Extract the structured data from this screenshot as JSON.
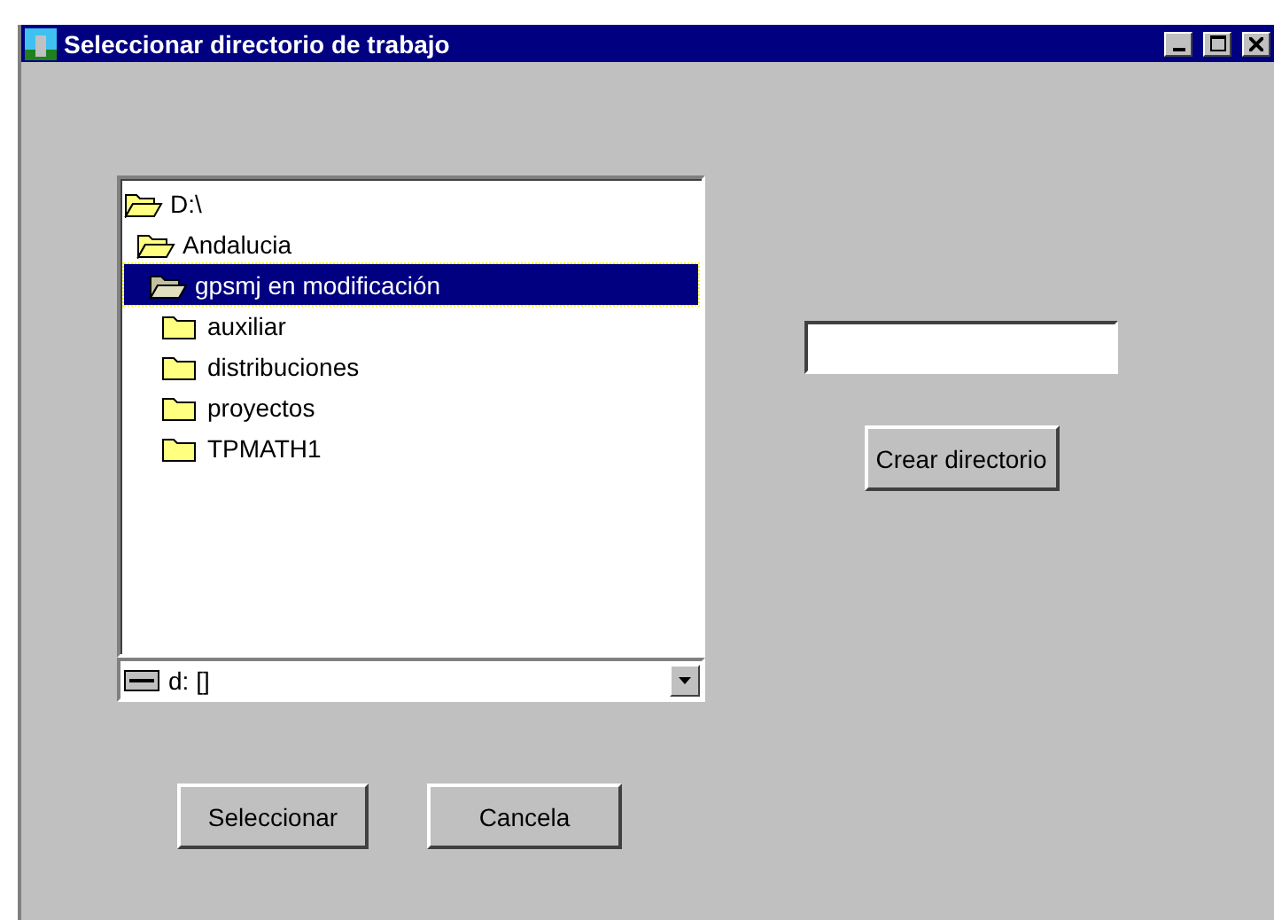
{
  "window": {
    "title": "Seleccionar directorio de trabajo"
  },
  "tree": [
    {
      "label": "D:\\",
      "expanded": true,
      "selected": false,
      "children": [
        {
          "label": "Andalucia",
          "expanded": true,
          "selected": false,
          "children": [
            {
              "label": "gpsmj en modificación",
              "expanded": true,
              "selected": true,
              "children": [
                {
                  "label": "auxiliar",
                  "expanded": false,
                  "selected": false
                },
                {
                  "label": "distribuciones",
                  "expanded": false,
                  "selected": false
                },
                {
                  "label": "proyectos",
                  "expanded": false,
                  "selected": false
                },
                {
                  "label": "TPMATH1",
                  "expanded": false,
                  "selected": false
                }
              ]
            }
          ]
        }
      ]
    }
  ],
  "drive": {
    "value": "d: []"
  },
  "new_folder": {
    "button": "Crear directorio"
  },
  "buttons": [
    "Seleccionar",
    "Cancela"
  ]
}
